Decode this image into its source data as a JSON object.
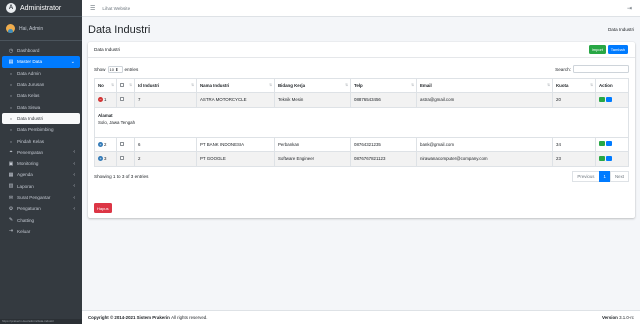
{
  "app": {
    "brand": "Administrator",
    "user": "Hai, Admin"
  },
  "sidebar": {
    "items": [
      {
        "label": "Dashboard",
        "icon": "dashboard-icon"
      },
      {
        "label": "Master Data",
        "icon": "database-icon"
      },
      {
        "label": "Data Admin",
        "icon": "circle-icon"
      },
      {
        "label": "Data Jurusan",
        "icon": "circle-icon"
      },
      {
        "label": "Data Kelas",
        "icon": "circle-icon"
      },
      {
        "label": "Data Siswa",
        "icon": "circle-icon"
      },
      {
        "label": "Data Industri",
        "icon": "circle-icon"
      },
      {
        "label": "Data Pembimbing",
        "icon": "circle-icon"
      },
      {
        "label": "Pindah Kelas",
        "icon": "circle-icon"
      },
      {
        "label": "Penempatan",
        "icon": "location-icon"
      },
      {
        "label": "Monitoring",
        "icon": "monitor-icon"
      },
      {
        "label": "Agenda",
        "icon": "calendar-icon"
      },
      {
        "label": "Laporan",
        "icon": "report-icon"
      },
      {
        "label": "Surat Pengantar",
        "icon": "mail-icon"
      },
      {
        "label": "Pengaturan",
        "icon": "gear-icon"
      },
      {
        "label": "Chatting",
        "icon": "chat-icon"
      },
      {
        "label": "Keluar",
        "icon": "logout-icon"
      }
    ],
    "status_url": "https://prakerin.dev/admin/data-industri"
  },
  "topbar": {
    "link": "Lihat Website"
  },
  "header": {
    "title": "Data Industri",
    "breadcrumb": "Data Industri"
  },
  "card": {
    "title": "Data Industri",
    "import_label": "Import",
    "tambah_label": "Tambah",
    "show_label": "Show",
    "entries_value": "10",
    "entries_label": "entries",
    "search_label": "Search:",
    "search_value": ""
  },
  "table": {
    "headers": [
      "No",
      "",
      "Id Industri",
      "Nama Industri",
      "Bidang Kerja",
      "Telp",
      "Email",
      "Kuota",
      "Action"
    ],
    "rows": [
      {
        "no": "1",
        "id": "7",
        "nama": "ASTRA MOTORCYCLE",
        "bidang": "Teknik Mesin",
        "telp": "08876543456",
        "email": "astra@gmail.com",
        "kuota": "20"
      },
      {
        "no": "2",
        "id": "6",
        "nama": "PT BANK INDONESIA",
        "bidang": "Perbankan",
        "telp": "08764321235",
        "email": "bank@gmail.com",
        "kuota": "34"
      },
      {
        "no": "3",
        "id": "2",
        "nama": "PT GOOGLE",
        "bidang": "Software Engineer",
        "telp": "0876767821123",
        "email": "nirawanacomputer@company.com",
        "kuota": "23"
      }
    ],
    "child": {
      "label": "Alamat",
      "value": "Solo, Jawa Tengah"
    }
  },
  "info": "Showing 1 to 3 of 3 entries",
  "pager": {
    "prev": "Previous",
    "page": "1",
    "next": "Next"
  },
  "hapus_label": "Hapus",
  "footer": {
    "copyright": "Copyright © 2014-2021 Sistem Prakerin",
    "rights": "All rights reserved.",
    "version_label": "Version",
    "version": "3.1.0-rc"
  }
}
